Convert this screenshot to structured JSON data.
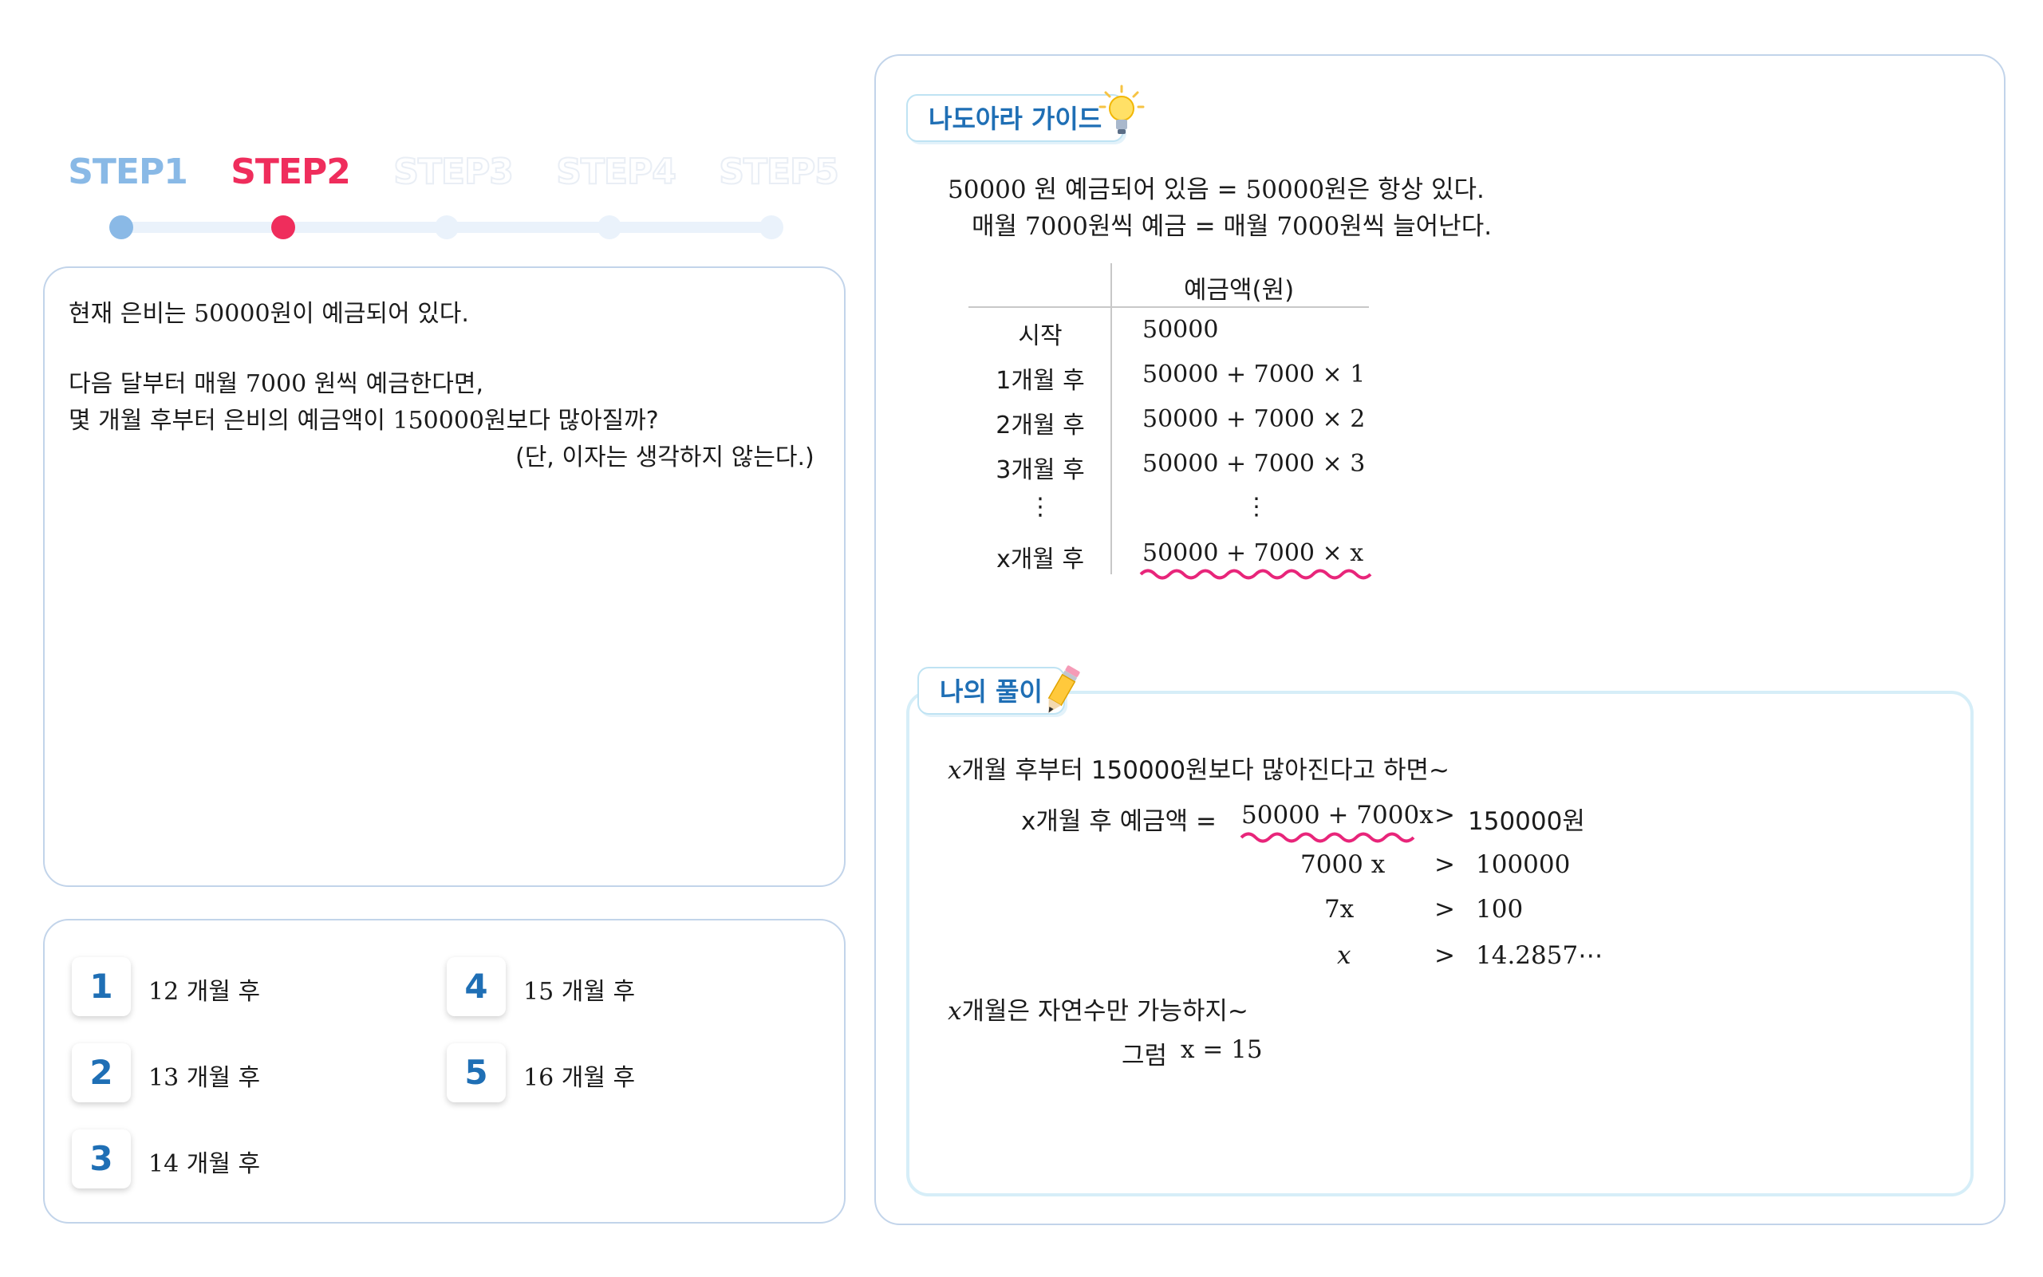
{
  "steps": [
    {
      "label": "STEP1",
      "state": "done"
    },
    {
      "label": "STEP2",
      "state": "active"
    },
    {
      "label": "STEP3",
      "state": "future"
    },
    {
      "label": "STEP4",
      "state": "future"
    },
    {
      "label": "STEP5",
      "state": "future"
    }
  ],
  "colors": {
    "accent": "#ef2d5c",
    "done": "#8ab9e6",
    "border": "#c2d4ea",
    "badge_text": "#1f6fb5"
  },
  "question": {
    "line1_pre": "현재 은비는",
    "line1_num": "50000",
    "line1_post": "원이 예금되어 있다.",
    "line2_pre": "다음 달부터 매월",
    "line2_num": "7000",
    "line2_post": "원씩 예금한다면,",
    "line3_pre": "몇 개월 후부터 은비의 예금액이",
    "line3_num": "150000",
    "line3_post": "원보다 많아질까?",
    "note": "(단, 이자는 생각하지 않는다.)"
  },
  "choices": [
    {
      "num": "1",
      "value": "12",
      "unit": "개월 후"
    },
    {
      "num": "2",
      "value": "13",
      "unit": "개월 후"
    },
    {
      "num": "3",
      "value": "14",
      "unit": "개월 후"
    },
    {
      "num": "4",
      "value": "15",
      "unit": "개월 후"
    },
    {
      "num": "5",
      "value": "16",
      "unit": "개월 후"
    }
  ],
  "guide": {
    "tag": "나도아라 가이드",
    "icon": "lightbulb-icon",
    "fact1_a": "50000",
    "fact1_b": "원 예금되어 있음 =",
    "fact1_c": "50000",
    "fact1_d": "원은 항상 있다.",
    "fact2_a": "매월",
    "fact2_b": "7000",
    "fact2_c": "원씩 예금 = 매월",
    "fact2_d": "7000",
    "fact2_e": "원씩 늘어난다.",
    "table_header": "예금액(원)",
    "rows": [
      {
        "label": "시작",
        "value": "50000"
      },
      {
        "label": "1개월 후",
        "value": "50000 + 7000 × 1"
      },
      {
        "label": "2개월 후",
        "value": "50000 + 7000 × 2"
      },
      {
        "label": "3개월 후",
        "value": "50000 + 7000 × 3"
      },
      {
        "label": "⋮",
        "value": "⋮"
      },
      {
        "label": "x개월 후",
        "value": "50000 + 7000 × x"
      }
    ]
  },
  "solution": {
    "tag": "나의 풀이",
    "icon": "pencil-icon",
    "intro_var": "x",
    "intro": "개월 후부터 150000원보다 많아진다고 하면~",
    "eq1_left": "x개월 후 예금액 =",
    "eq1_expr": "50000 + 7000x",
    "eq1_op": ">",
    "eq1_right": "150000원",
    "eq2_left": "7000 x",
    "eq2_op": ">",
    "eq2_right": "100000",
    "eq3_left": "7x",
    "eq3_op": ">",
    "eq3_right": "100",
    "eq4_left": "x",
    "eq4_op": ">",
    "eq4_right": "14.2857⋯",
    "nat_var": "x",
    "nat": "개월은 자연수만 가능하지~",
    "then": "그럼",
    "answer": "x = 15"
  }
}
